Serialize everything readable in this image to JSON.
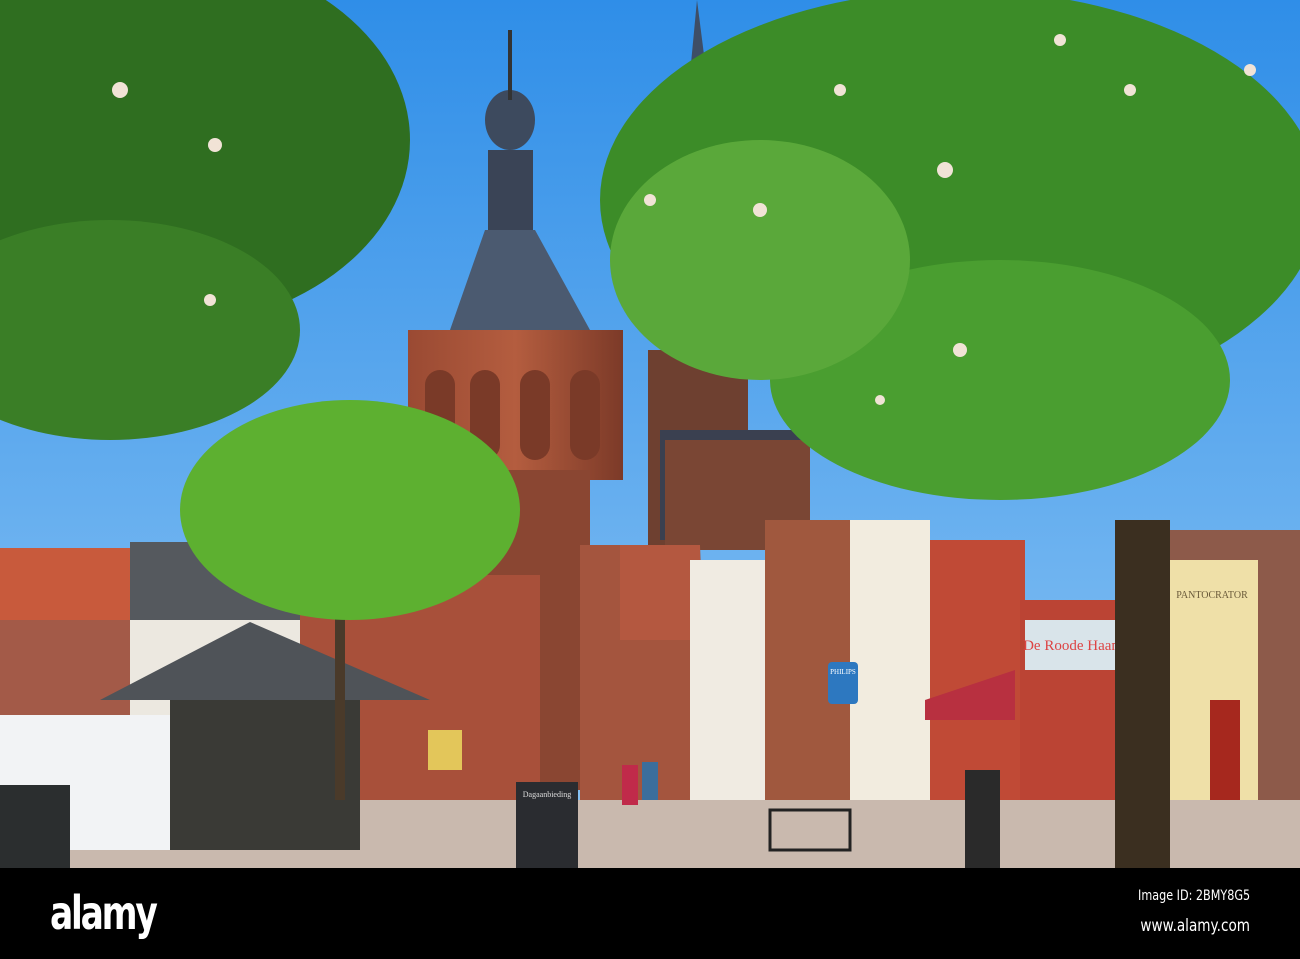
{
  "photo": {
    "signs": {
      "philips": "PHILIPS",
      "shop": "De Roode Haan",
      "pantocrator": "PANTOCRATOR",
      "menu_board": "Dagaanbieding"
    }
  },
  "footer": {
    "logo": "alamy",
    "image_id": "Image ID: 2BMY8G5",
    "url": "www.alamy.com"
  }
}
